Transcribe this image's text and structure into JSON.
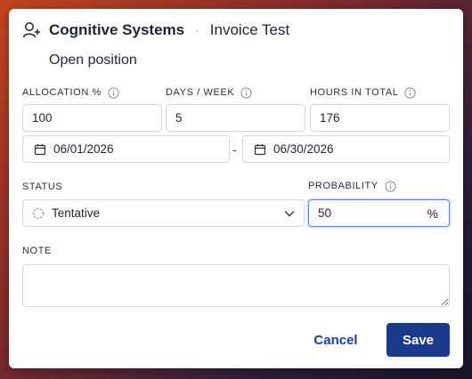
{
  "header": {
    "client": "Cognitive Systems",
    "separator": "·",
    "project": "Invoice Test",
    "icon": "user-plus-icon"
  },
  "subtitle": "Open position",
  "fields": {
    "allocation": {
      "label": "ALLOCATION %",
      "value": "100"
    },
    "days_per_week": {
      "label": "DAYS / WEEK",
      "value": "5"
    },
    "hours_total": {
      "label": "HOURS IN TOTAL",
      "value": "176"
    },
    "start_date": {
      "value": "06/01/2026"
    },
    "date_separator": "-",
    "end_date": {
      "value": "06/30/2026"
    },
    "status": {
      "label": "STATUS",
      "value": "Tentative",
      "icon": "dashed-circle-icon"
    },
    "probability": {
      "label": "PROBABILITY",
      "value": "50",
      "suffix": "%"
    },
    "note": {
      "label": "NOTE",
      "value": ""
    }
  },
  "actions": {
    "cancel_label": "Cancel",
    "save_label": "Save"
  },
  "colors": {
    "primary": "#1a3a8c",
    "focus": "#5b7fd6"
  }
}
